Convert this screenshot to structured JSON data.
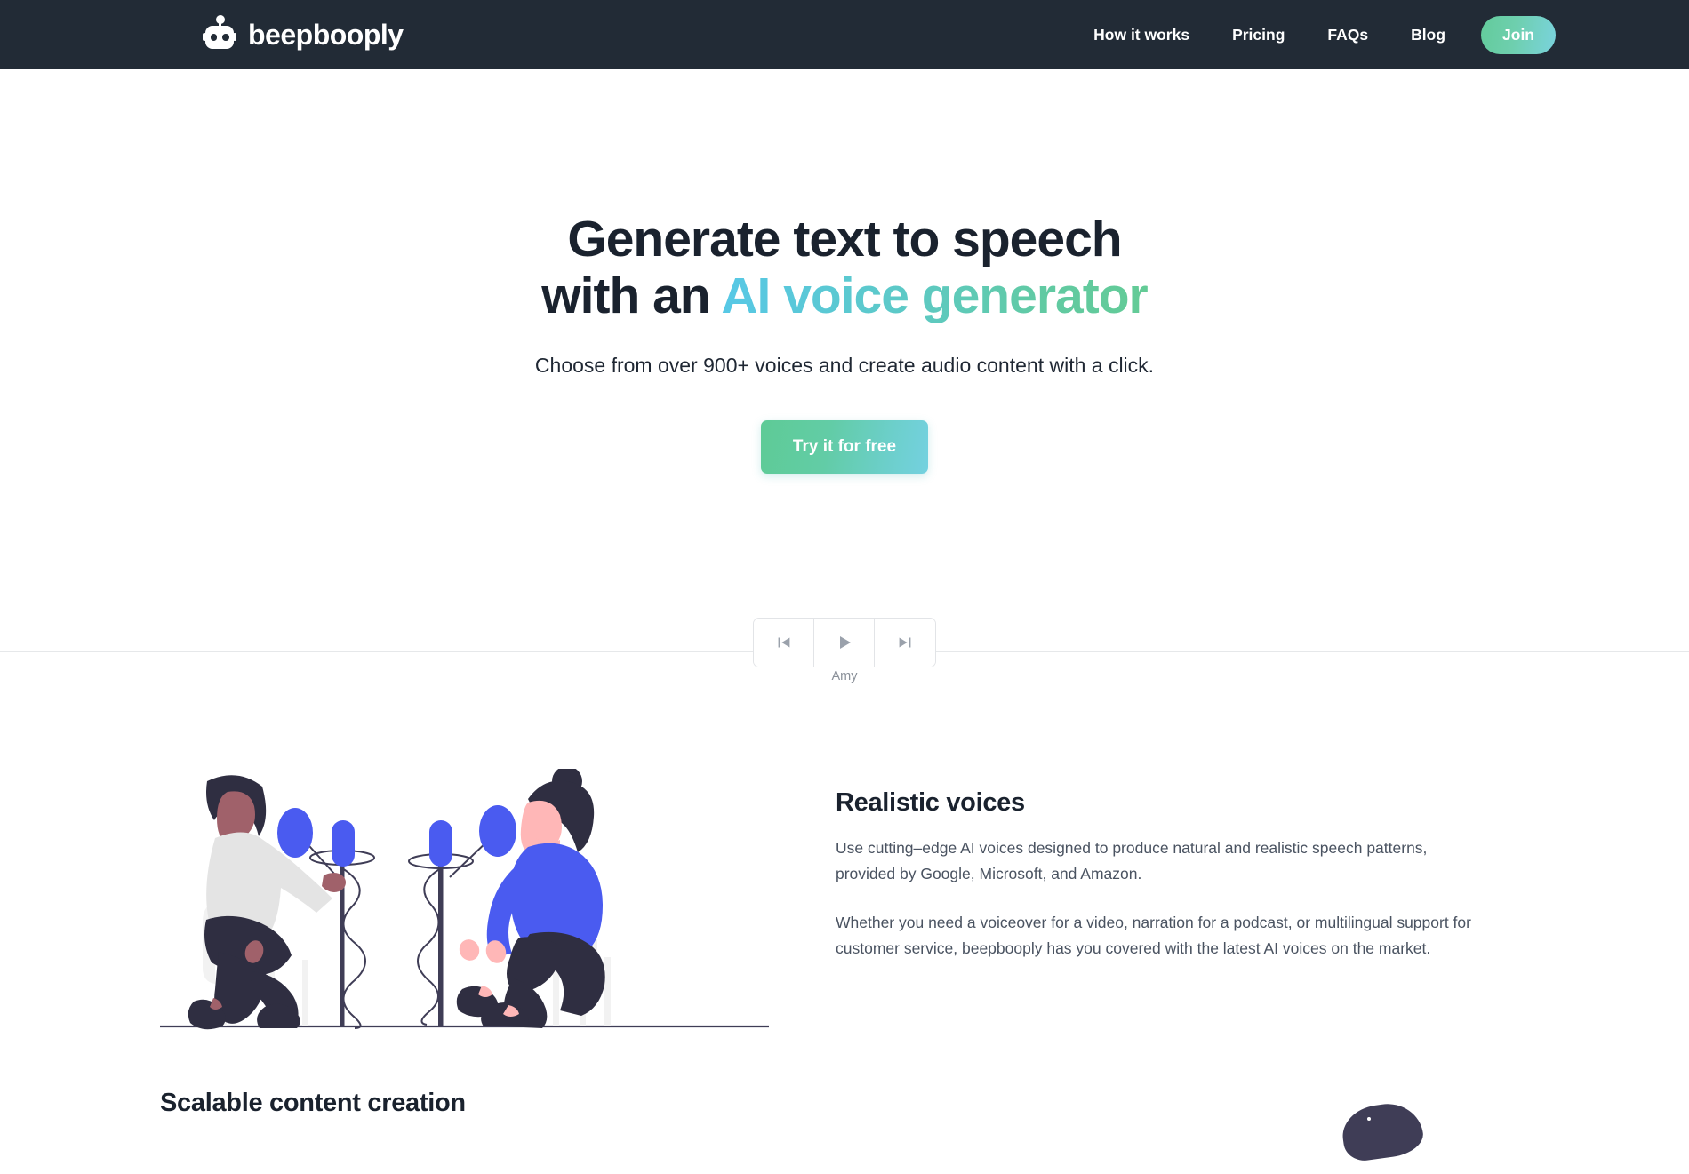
{
  "brand": {
    "name": "beepbooply",
    "icon": "robot-head-icon"
  },
  "nav": {
    "links": [
      {
        "label": "How it works"
      },
      {
        "label": "Pricing"
      },
      {
        "label": "FAQs"
      },
      {
        "label": "Blog"
      }
    ],
    "join_label": "Join"
  },
  "hero": {
    "title_line1": "Generate text to speech",
    "title_line2_prefix": "with an ",
    "title_line2_accent": "AI voice generator",
    "subtitle": "Choose from over 900+ voices and create audio content with a click.",
    "cta_label": "Try it for free"
  },
  "player": {
    "previous_icon": "skip-previous-icon",
    "play_icon": "play-icon",
    "next_icon": "skip-next-icon",
    "voice_name": "Amy"
  },
  "features": [
    {
      "title": "Realistic voices",
      "paragraph1": "Use cutting–edge AI voices designed to produce natural and realistic speech patterns, provided by Google, Microsoft, and Amazon.",
      "paragraph2": "Whether you need a voiceover for a video, narration for a podcast, or multilingual support for customer service, beepbooply has you covered with the latest AI voices on the market."
    }
  ],
  "next_section": {
    "title": "Scalable content creation"
  },
  "colors": {
    "header_bg": "#222b36",
    "accent_green": "#63cb96",
    "accent_cyan": "#57c8e6",
    "heading": "#1a222e",
    "body_text": "#4a5361",
    "muted": "#8a9099",
    "illustration_blue": "#4a5bf0",
    "illustration_dark": "#2f2e41",
    "illustration_skin_light": "#ffb7b7",
    "illustration_skin_dark": "#a0616a"
  }
}
